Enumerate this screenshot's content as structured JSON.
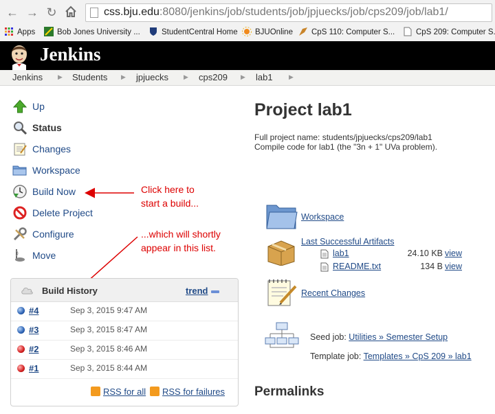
{
  "browser": {
    "url_host": "css.bju.edu",
    "url_rest": ":8080/jenkins/job/students/job/jpjuecks/job/cps209/job/lab1/",
    "bookmarks": [
      "Apps",
      "Bob Jones University ...",
      "StudentCentral Home",
      "BJUOnline",
      "CpS 110: Computer S...",
      "CpS 209: Computer S..."
    ]
  },
  "header": {
    "title": "Jenkins"
  },
  "breadcrumb": [
    "Jenkins",
    "Students",
    "jpjuecks",
    "cps209",
    "lab1"
  ],
  "sidebar": {
    "tasks": [
      {
        "label": "Up",
        "icon": "up-arrow-icon"
      },
      {
        "label": "Status",
        "icon": "magnifier-icon"
      },
      {
        "label": "Changes",
        "icon": "notepad-icon"
      },
      {
        "label": "Workspace",
        "icon": "folder-icon"
      },
      {
        "label": "Build Now",
        "icon": "clock-icon"
      },
      {
        "label": "Delete Project",
        "icon": "no-entry-icon"
      },
      {
        "label": "Configure",
        "icon": "wrench-icon"
      },
      {
        "label": "Move",
        "icon": "move-icon"
      }
    ]
  },
  "annotations": {
    "build_now": [
      "Click here to",
      "start a build..."
    ],
    "history": [
      "...which will shortly",
      "appear in this list."
    ]
  },
  "build_history": {
    "title": "Build History",
    "trend": "trend",
    "builds": [
      {
        "number": "#4",
        "date": "Sep 3, 2015 9:47 AM",
        "status": "blue"
      },
      {
        "number": "#3",
        "date": "Sep 3, 2015 8:47 AM",
        "status": "blue"
      },
      {
        "number": "#2",
        "date": "Sep 3, 2015 8:46 AM",
        "status": "red"
      },
      {
        "number": "#1",
        "date": "Sep 3, 2015 8:44 AM",
        "status": "red"
      }
    ],
    "rss_all": "RSS for all",
    "rss_failures": "RSS for failures"
  },
  "main": {
    "title": "Project lab1",
    "desc_line1": "Full project name: students/jpjuecks/cps209/lab1",
    "desc_line2": "Compile code for lab1 (the \"3n + 1\" UVa problem).",
    "workspace": "Workspace",
    "artifacts_title": "Last Successful Artifacts",
    "artifacts": [
      {
        "name": "lab1",
        "size": "24.10 KB",
        "view": "view"
      },
      {
        "name": "README.txt",
        "size": "134 B",
        "view": "view"
      }
    ],
    "recent_changes": "Recent Changes",
    "seed_label": "Seed job: ",
    "seed_link": "Utilities » Semester Setup",
    "template_label": "Template job: ",
    "template_link": "Templates » CpS 209 » lab1",
    "permalinks": "Permalinks"
  }
}
